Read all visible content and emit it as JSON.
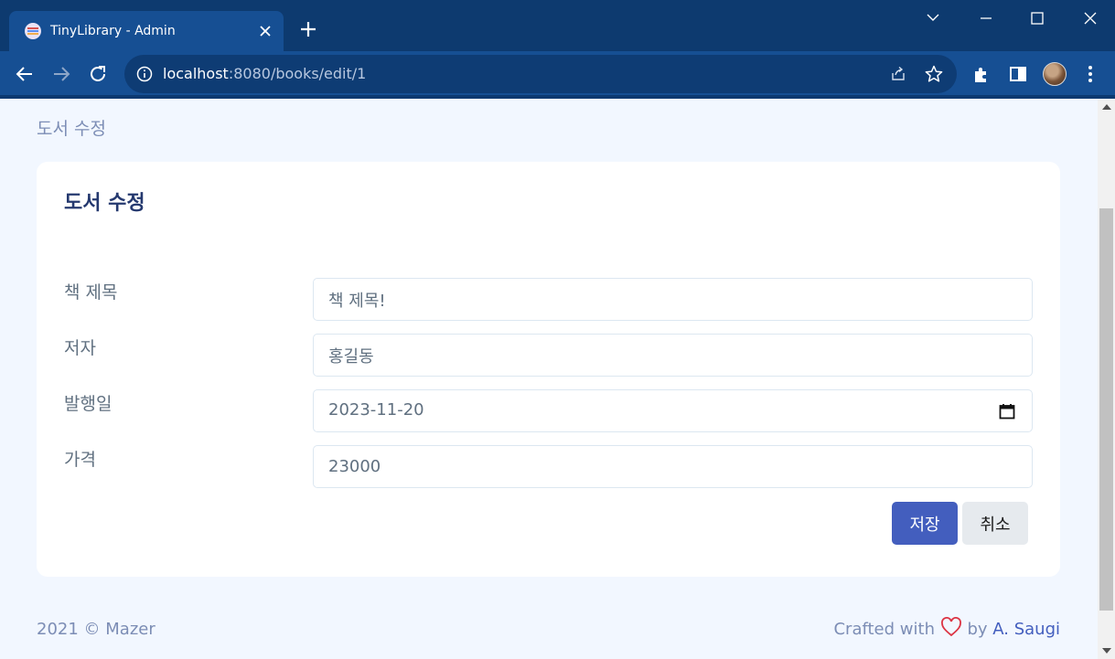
{
  "browser": {
    "tab_title": "TinyLibrary - Admin",
    "url_host": "localhost",
    "url_rest": ":8080/books/edit/1",
    "icons": [
      "favicon",
      "close-icon",
      "plus-icon",
      "chevron-down-icon",
      "minimize-icon",
      "maximize-icon",
      "close-window-icon",
      "back-arrow-icon",
      "forward-arrow-icon",
      "reload-icon",
      "info-icon",
      "share-icon",
      "star-icon",
      "extensions-icon",
      "side-panel-icon",
      "avatar",
      "kebab-menu-icon"
    ]
  },
  "page": {
    "subtitle": "도서 수정"
  },
  "card": {
    "title": "도서 수정",
    "fields": {
      "title": {
        "label": "책 제목",
        "value": "책 제목!"
      },
      "author": {
        "label": "저자",
        "value": "홍길동"
      },
      "published": {
        "label": "발행일",
        "value": "2023-11-20"
      },
      "price": {
        "label": "가격",
        "value": "23000"
      }
    },
    "save_label": "저장",
    "cancel_label": "취소"
  },
  "footer": {
    "copyright": "2021 © Mazer",
    "crafted_prefix": "Crafted with",
    "crafted_by": "by",
    "author_link": "A. Saugi"
  },
  "colors": {
    "primary": "#435ebe",
    "heart": "#dc3545",
    "page_bg": "#f2f7ff",
    "heading": "#25396f"
  }
}
